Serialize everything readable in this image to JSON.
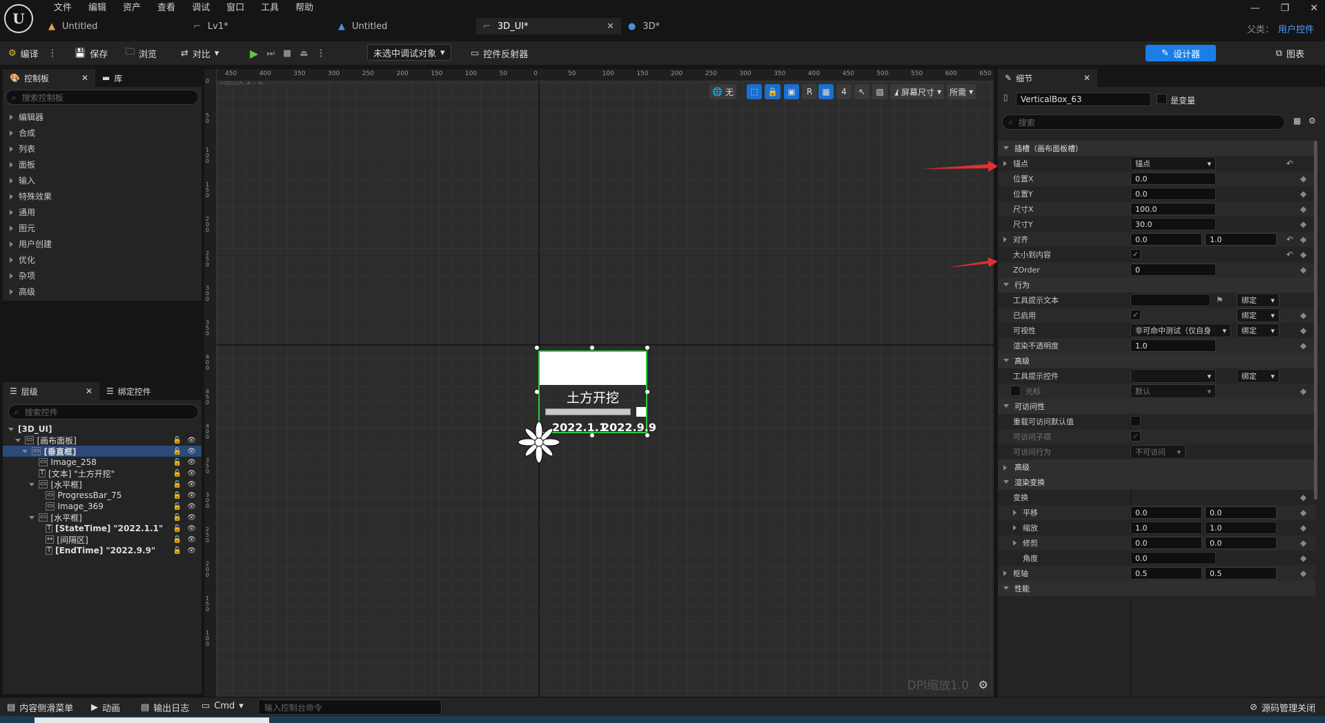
{
  "menu": [
    "文件",
    "编辑",
    "资产",
    "查看",
    "调试",
    "窗口",
    "工具",
    "帮助"
  ],
  "tabs": [
    {
      "label": "Untitled",
      "icon": "map-icon"
    },
    {
      "label": "Lv1*",
      "icon": "level-icon"
    },
    {
      "label": "Untitled",
      "icon": "map-icon"
    },
    {
      "label": "3D_UI*",
      "icon": "widget-icon",
      "active": true
    },
    {
      "label": "3D*",
      "icon": "sphere-icon"
    }
  ],
  "parent": {
    "label": "父类：",
    "value": "用户控件"
  },
  "toolbar": {
    "compile": "编译",
    "save": "保存",
    "browse": "浏览",
    "diff": "对比",
    "debug_target": "未选中调试对象",
    "reflector": "控件反射器",
    "designer": "设计器",
    "graph": "图表"
  },
  "palette": {
    "tab": "控制板",
    "lib_tab": "库",
    "search_placeholder": "搜索控制板",
    "categories": [
      "编辑器",
      "合成",
      "列表",
      "面板",
      "输入",
      "特殊效果",
      "通用",
      "图元",
      "用户创建",
      "优化",
      "杂项",
      "高级"
    ]
  },
  "hierarchy": {
    "tab": "层级",
    "bind_tab": "绑定控件",
    "search_placeholder": "搜索控件",
    "items": [
      {
        "label": "[3D_UI]",
        "indent": 0,
        "bold": true
      },
      {
        "label": "[画布面板]",
        "indent": 1
      },
      {
        "label": "[垂直框]",
        "indent": 2,
        "selected": true,
        "bold": true
      },
      {
        "label": "Image_258",
        "indent": 3
      },
      {
        "label": "[文本] \"土方开挖\"",
        "indent": 3
      },
      {
        "label": "[水平框]",
        "indent": 3
      },
      {
        "label": "ProgressBar_75",
        "indent": 4
      },
      {
        "label": "Image_369",
        "indent": 4
      },
      {
        "label": "[水平框]",
        "indent": 3
      },
      {
        "label": "[StateTime] \"2022.1.1\"",
        "indent": 4,
        "bold": true
      },
      {
        "label": "[间隔区]",
        "indent": 4
      },
      {
        "label": "[EndTime] \"2022.9.9\"",
        "indent": 4,
        "bold": true
      }
    ]
  },
  "viewport": {
    "zoom": "缩放1:1",
    "dpi": "DPI缩放1.0",
    "btn_none": "无",
    "btn_r": "R",
    "grid_num": "4",
    "screen_size": "屏幕尺寸",
    "fill": "所需",
    "ruler_top": [
      "450",
      "400",
      "350",
      "300",
      "250",
      "200",
      "150",
      "100",
      "50",
      "0",
      "50",
      "100",
      "150",
      "200",
      "250",
      "300",
      "350",
      "400",
      "450",
      "500",
      "550",
      "600",
      "650"
    ],
    "widget": {
      "title": "土方开挖",
      "start": "2022.1.1",
      "end": "2022.9.9"
    }
  },
  "details": {
    "tab": "细节",
    "name": "VerticalBox_63",
    "is_var": "是变量",
    "search_placeholder": "搜索",
    "slot_section": "插槽（画布面板槽）",
    "anchor_label": "锚点",
    "anchor_value": "锚点",
    "pos_x_label": "位置X",
    "pos_x": "0.0",
    "pos_y_label": "位置Y",
    "pos_y": "0.0",
    "size_x_label": "尺寸X",
    "size_x": "100.0",
    "size_y_label": "尺寸Y",
    "size_y": "30.0",
    "align_label": "对齐",
    "align_x": "0.0",
    "align_y": "1.0",
    "autosize_label": "大小到内容",
    "zorder_label": "ZOrder",
    "zorder": "0",
    "behavior_section": "行为",
    "tooltip_label": "工具提示文本",
    "bind": "绑定",
    "enabled_label": "已启用",
    "visibility_label": "可视性",
    "visibility_value": "非可命中测试（仅自身",
    "opacity_label": "渲染不透明度",
    "opacity": "1.0",
    "advanced_section": "高级",
    "tooltip_widget_label": "工具提示控件",
    "cursor_label": "光标",
    "cursor_value": "默认",
    "access_section": "可访问性",
    "override_access": "重载可访问默认值",
    "access_children": "可访问子项",
    "access_behavior": "可访问行为",
    "access_behavior_value": "不可访问",
    "advanced2": "高级",
    "render_transform": "渲染变换",
    "transform": "变换",
    "translation": "平移",
    "tx": "0.0",
    "ty": "0.0",
    "scale": "缩放",
    "sx": "1.0",
    "sy": "1.0",
    "shear": "修剪",
    "shx": "0.0",
    "shy": "0.0",
    "angle": "角度",
    "angle_v": "0.0",
    "pivot": "枢轴",
    "px": "0.5",
    "py": "0.5",
    "perf": "性能"
  },
  "status": {
    "content_drawer": "内容侧滑菜单",
    "anim": "动画",
    "output_log": "输出日志",
    "cmd": "Cmd",
    "console_placeholder": "输入控制台命令",
    "source_control": "源码管理关闭"
  },
  "colors": {
    "accent": "#1a7ee6",
    "selection": "#2b4a7a",
    "widget_border": "#2ecc40",
    "arrow": "#e03030"
  }
}
